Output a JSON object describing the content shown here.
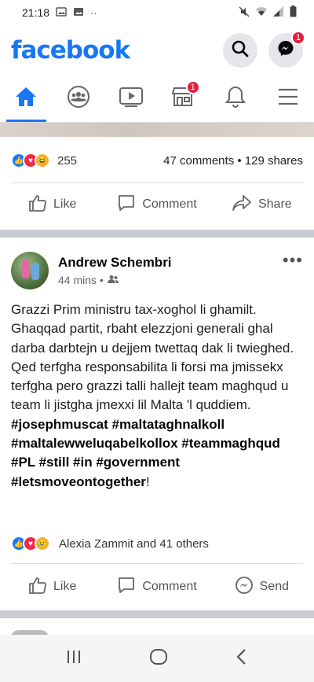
{
  "status_bar": {
    "time": "21:18",
    "left_icons": [
      "image-icon",
      "gallery-icon",
      "more-dots-icon"
    ],
    "right_icons": [
      "mute-icon",
      "wifi-icon",
      "signal-icon",
      "battery-icon"
    ]
  },
  "header": {
    "logo": "facebook",
    "messenger_badge": "1"
  },
  "tabs": [
    {
      "name": "home",
      "active": true
    },
    {
      "name": "groups"
    },
    {
      "name": "watch"
    },
    {
      "name": "marketplace",
      "badge": "1"
    },
    {
      "name": "notifications"
    },
    {
      "name": "menu"
    }
  ],
  "prev_post": {
    "reaction_count": "255",
    "comments_shares": "47 comments • 129 shares",
    "actions": {
      "like": "Like",
      "comment": "Comment",
      "share": "Share"
    }
  },
  "post": {
    "author": "Andrew Schembri",
    "time": "44 mins •",
    "text": "Grazzi Prim ministru tax-xoghol li ghamilt. Ghaqqad partit, rbaht elezzjoni generali ghal darba darbtejn u dejjem twettaq dak li twieghed. Qed terfgha responsabilita li forsi ma jmissekx terfgha pero grazzi talli hallejt team maghqud u team li jistgha jmexxi lil Malta 'l quddiem.",
    "hashtags": "#josephmuscat #maltataghnalkoll #maltalewweluqabelkollox #teammaghqud #PL #still #in #government #letsmoveontogether",
    "hashtags_end": "!",
    "reactions_text": "Alexia Zammit and 41 others",
    "actions": {
      "like": "Like",
      "comment": "Comment",
      "send": "Send"
    }
  },
  "colors": {
    "brand": "#1877f2",
    "badge": "#e41e3f"
  }
}
